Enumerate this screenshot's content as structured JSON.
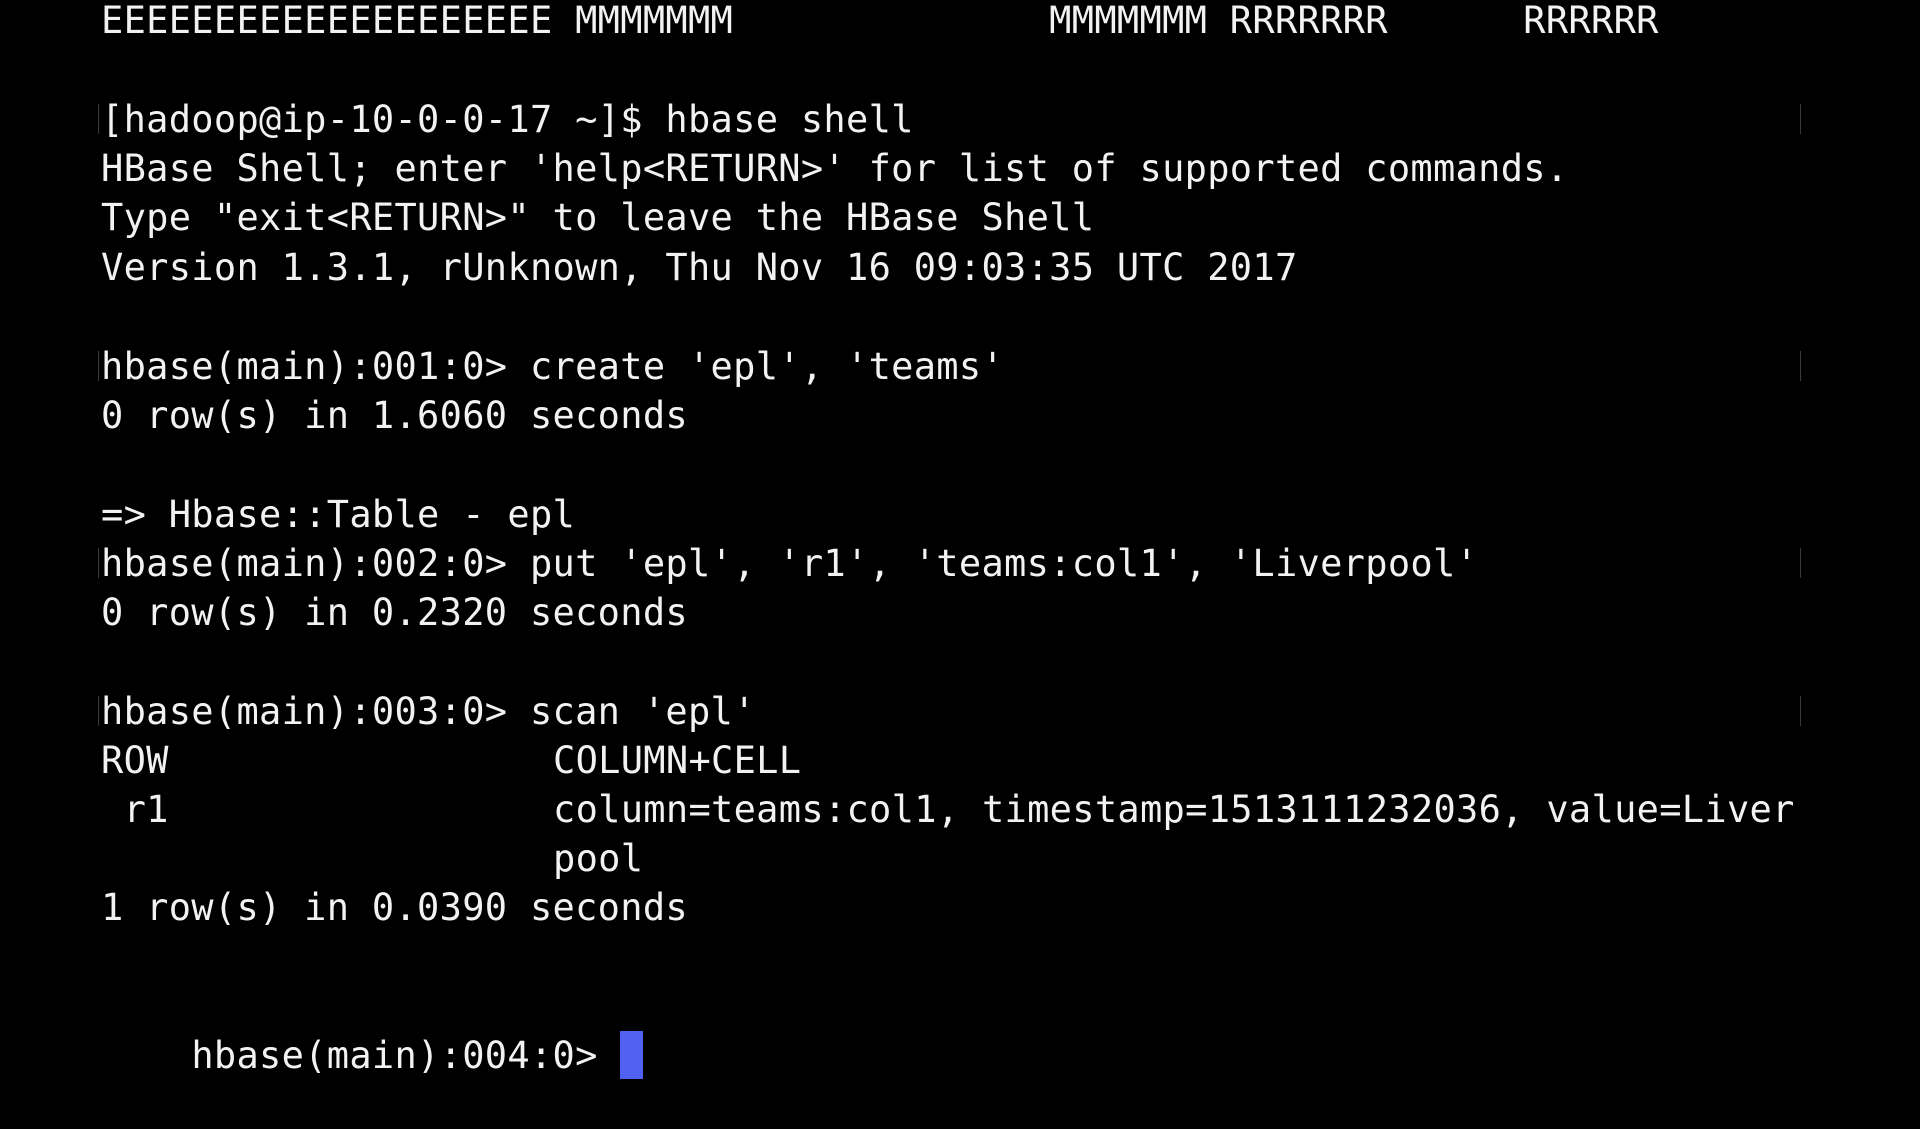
{
  "terminal": {
    "header": "EEEEEEEEEEEEEEEEEEEE MMMMMMM              MMMMMMM RRRRRRR      RRRRRR",
    "login_prompt": "[hadoop@ip-10-0-0-17 ~]$ hbase shell",
    "banner_1": "HBase Shell; enter 'help<RETURN>' for list of supported commands.",
    "banner_2": "Type \"exit<RETURN>\" to leave the HBase Shell",
    "banner_3": "Version 1.3.1, rUnknown, Thu Nov 16 09:03:35 UTC 2017",
    "cmd_1": "hbase(main):001:0> create 'epl', 'teams'",
    "out_1": "0 row(s) in 1.6060 seconds",
    "out_1b": "=> Hbase::Table - epl",
    "cmd_2": "hbase(main):002:0> put 'epl', 'r1', 'teams:col1', 'Liverpool'",
    "out_2": "0 row(s) in 0.2320 seconds",
    "cmd_3": "hbase(main):003:0> scan 'epl'",
    "scan_header_row": "ROW",
    "scan_header_cell": "COLUMN+CELL",
    "scan_row_key": " r1",
    "scan_row_cell": "column=teams:col1, timestamp=1513111232036, value=Liver",
    "scan_row_cell_wrap": "pool",
    "out_3": "1 row(s) in 0.0390 seconds",
    "current_prompt": "hbase(main):004:0> "
  },
  "colors": {
    "background": "#000000",
    "text": "#f2f2f2",
    "cursor": "#5060f0"
  }
}
